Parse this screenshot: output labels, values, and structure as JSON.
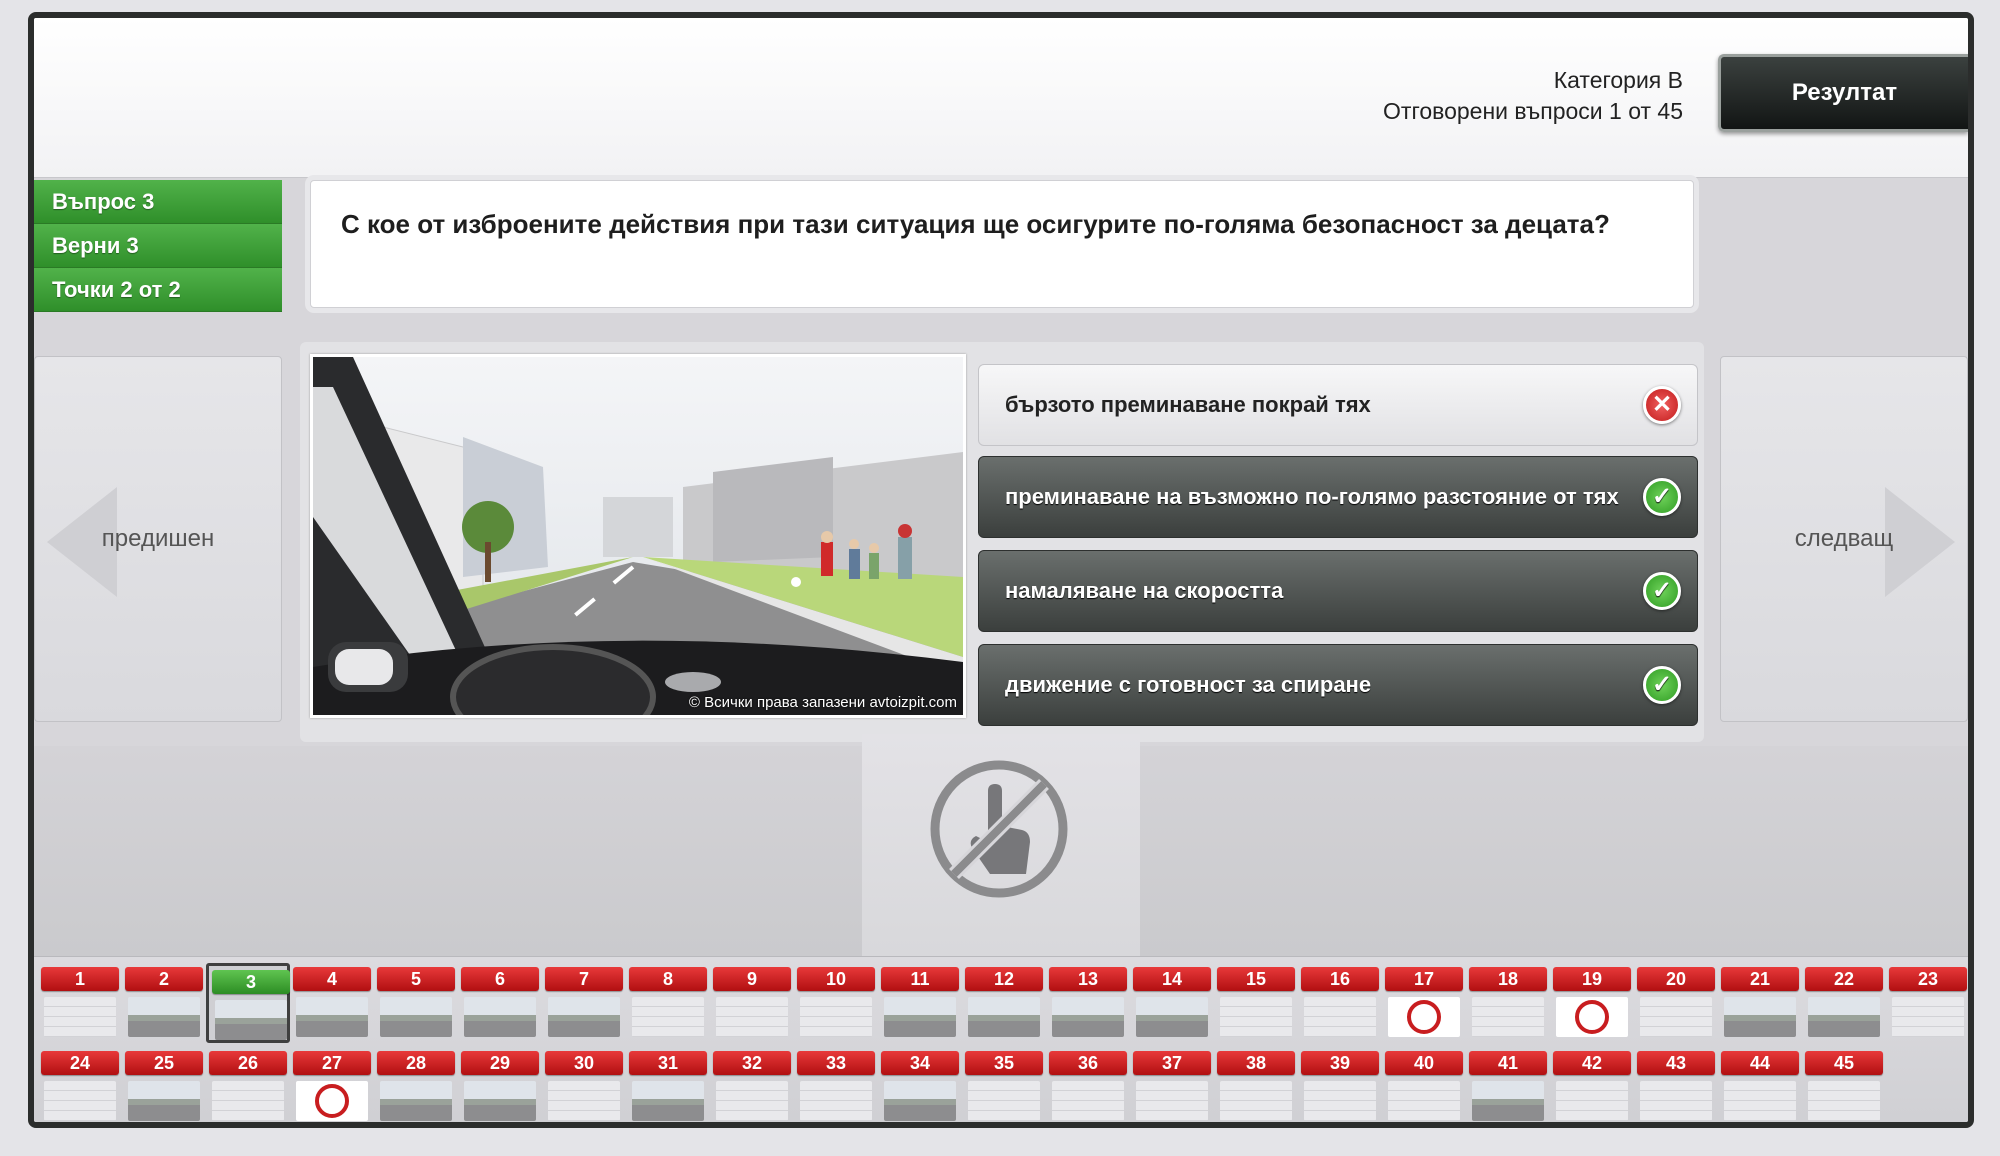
{
  "header": {
    "category": "Категория B",
    "answered": "Отговорени въпроси 1 от 45",
    "result_label": "Резултат"
  },
  "status": {
    "question": "Въпрос 3",
    "correct": "Верни 3",
    "points": "Точки 2 от 2"
  },
  "question_text": "С кое от изброените действия при тази ситуация ще осигурите по-голяма безопасност за децата?",
  "nav": {
    "prev": "предишен",
    "next": "следващ"
  },
  "photo": {
    "copyright": "© Всички права запазени avtoizpit.com"
  },
  "answers": [
    {
      "text": "бързото преминаване покрай тях",
      "selected": false,
      "result": "wrong"
    },
    {
      "text": "преминаване на възможно по-голямо разстояние от тях",
      "selected": true,
      "result": "right"
    },
    {
      "text": "намаляване на скоростта",
      "selected": true,
      "result": "right"
    },
    {
      "text": "движение с готовност за спиране",
      "selected": true,
      "result": "right"
    }
  ],
  "grid": {
    "current": 3,
    "items": [
      {
        "n": "1",
        "thumb": "none"
      },
      {
        "n": "2",
        "thumb": "pic"
      },
      {
        "n": "3",
        "thumb": "pic"
      },
      {
        "n": "4",
        "thumb": "pic"
      },
      {
        "n": "5",
        "thumb": "pic"
      },
      {
        "n": "6",
        "thumb": "pic"
      },
      {
        "n": "7",
        "thumb": "pic"
      },
      {
        "n": "8",
        "thumb": "none"
      },
      {
        "n": "9",
        "thumb": "none"
      },
      {
        "n": "10",
        "thumb": "none"
      },
      {
        "n": "11",
        "thumb": "pic"
      },
      {
        "n": "12",
        "thumb": "pic"
      },
      {
        "n": "13",
        "thumb": "pic"
      },
      {
        "n": "14",
        "thumb": "pic"
      },
      {
        "n": "15",
        "thumb": "none"
      },
      {
        "n": "16",
        "thumb": "none"
      },
      {
        "n": "17",
        "thumb": "sign"
      },
      {
        "n": "18",
        "thumb": "none"
      },
      {
        "n": "19",
        "thumb": "sign"
      },
      {
        "n": "20",
        "thumb": "none"
      },
      {
        "n": "21",
        "thumb": "pic"
      },
      {
        "n": "22",
        "thumb": "pic"
      },
      {
        "n": "23",
        "thumb": "none"
      },
      {
        "n": "24",
        "thumb": "none"
      },
      {
        "n": "25",
        "thumb": "pic"
      },
      {
        "n": "26",
        "thumb": "none"
      },
      {
        "n": "27",
        "thumb": "sign"
      },
      {
        "n": "28",
        "thumb": "pic"
      },
      {
        "n": "29",
        "thumb": "pic"
      },
      {
        "n": "30",
        "thumb": "none"
      },
      {
        "n": "31",
        "thumb": "pic"
      },
      {
        "n": "32",
        "thumb": "none"
      },
      {
        "n": "33",
        "thumb": "none"
      },
      {
        "n": "34",
        "thumb": "pic"
      },
      {
        "n": "35",
        "thumb": "none"
      },
      {
        "n": "36",
        "thumb": "none"
      },
      {
        "n": "37",
        "thumb": "none"
      },
      {
        "n": "38",
        "thumb": "none"
      },
      {
        "n": "39",
        "thumb": "none"
      },
      {
        "n": "40",
        "thumb": "none"
      },
      {
        "n": "41",
        "thumb": "pic"
      },
      {
        "n": "42",
        "thumb": "none"
      },
      {
        "n": "43",
        "thumb": "none"
      },
      {
        "n": "44",
        "thumb": "none"
      },
      {
        "n": "45",
        "thumb": "none"
      }
    ]
  },
  "colors": {
    "accent_green": "#3a9b33",
    "badge_red": "#c81d1f",
    "dark_button": "#1e2221"
  },
  "icons": {
    "wrong": "close-circle-icon",
    "right": "check-circle-icon",
    "no_touch": "no-touch-icon"
  }
}
